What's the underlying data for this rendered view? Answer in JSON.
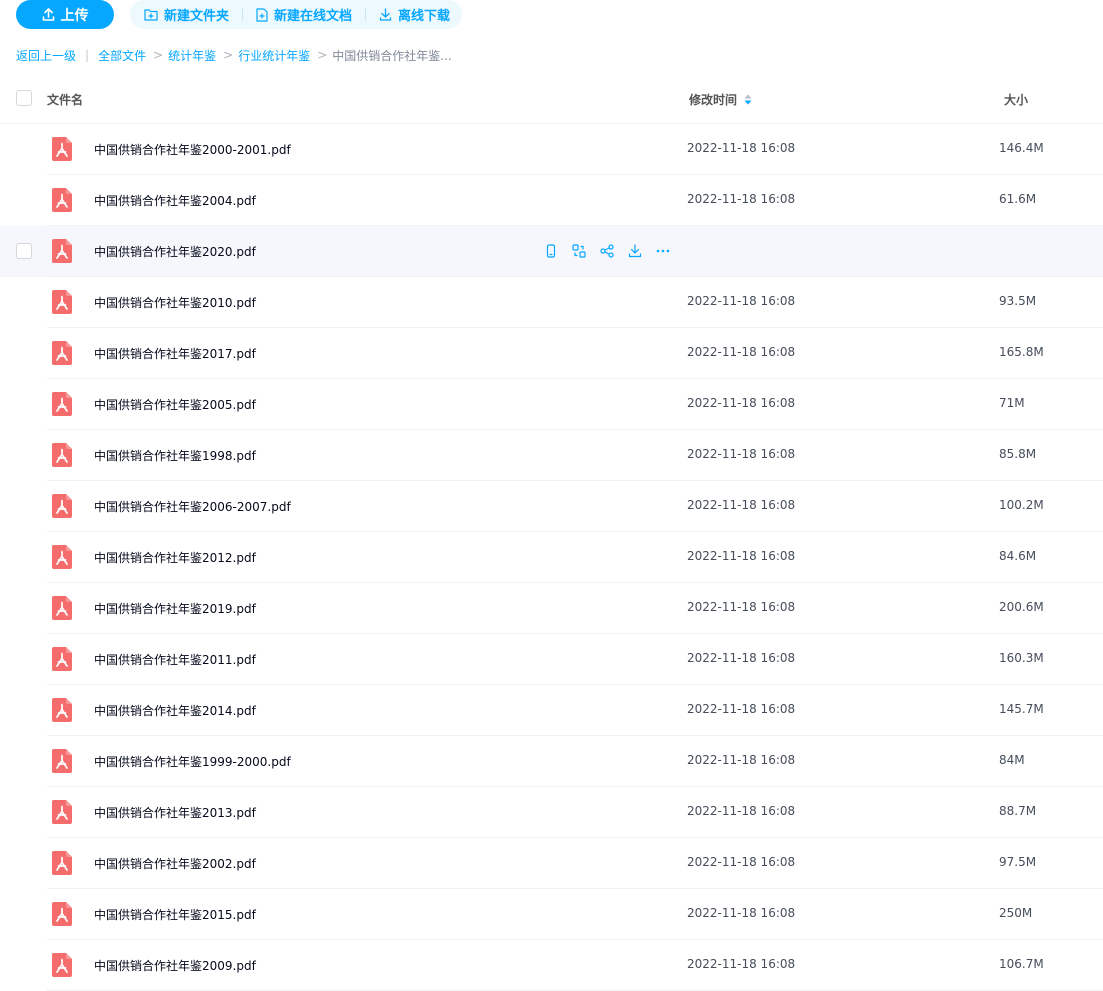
{
  "toolbar": {
    "upload_label": "上传",
    "new_folder_label": "新建文件夹",
    "new_online_doc_label": "新建在线文档",
    "offline_download_label": "离线下载"
  },
  "breadcrumb": {
    "back": "返回上一级",
    "items": [
      "全部文件",
      "统计年鉴",
      "行业统计年鉴"
    ],
    "current": "中国供销合作社年鉴..."
  },
  "columns": {
    "name": "文件名",
    "modified": "修改时间",
    "size": "大小"
  },
  "colors": {
    "accent": "#06a7ff",
    "pdf_icon": "#f56c6c"
  },
  "files": [
    {
      "name": "中国供销合作社年鉴2000-2001.pdf",
      "time": "2022-11-18 16:08",
      "size": "146.4M"
    },
    {
      "name": "中国供销合作社年鉴2004.pdf",
      "time": "2022-11-18 16:08",
      "size": "61.6M"
    },
    {
      "name": "中国供销合作社年鉴2020.pdf",
      "time": "",
      "size": ""
    },
    {
      "name": "中国供销合作社年鉴2010.pdf",
      "time": "2022-11-18 16:08",
      "size": "93.5M"
    },
    {
      "name": "中国供销合作社年鉴2017.pdf",
      "time": "2022-11-18 16:08",
      "size": "165.8M"
    },
    {
      "name": "中国供销合作社年鉴2005.pdf",
      "time": "2022-11-18 16:08",
      "size": "71M"
    },
    {
      "name": "中国供销合作社年鉴1998.pdf",
      "time": "2022-11-18 16:08",
      "size": "85.8M"
    },
    {
      "name": "中国供销合作社年鉴2006-2007.pdf",
      "time": "2022-11-18 16:08",
      "size": "100.2M"
    },
    {
      "name": "中国供销合作社年鉴2012.pdf",
      "time": "2022-11-18 16:08",
      "size": "84.6M"
    },
    {
      "name": "中国供销合作社年鉴2019.pdf",
      "time": "2022-11-18 16:08",
      "size": "200.6M"
    },
    {
      "name": "中国供销合作社年鉴2011.pdf",
      "time": "2022-11-18 16:08",
      "size": "160.3M"
    },
    {
      "name": "中国供销合作社年鉴2014.pdf",
      "time": "2022-11-18 16:08",
      "size": "145.7M"
    },
    {
      "name": "中国供销合作社年鉴1999-2000.pdf",
      "time": "2022-11-18 16:08",
      "size": "84M"
    },
    {
      "name": "中国供销合作社年鉴2013.pdf",
      "time": "2022-11-18 16:08",
      "size": "88.7M"
    },
    {
      "name": "中国供销合作社年鉴2002.pdf",
      "time": "2022-11-18 16:08",
      "size": "97.5M"
    },
    {
      "name": "中国供销合作社年鉴2015.pdf",
      "time": "2022-11-18 16:08",
      "size": "250M"
    },
    {
      "name": "中国供销合作社年鉴2009.pdf",
      "time": "2022-11-18 16:08",
      "size": "106.7M"
    }
  ],
  "hover_row_actions": [
    "mobile-icon",
    "convert-icon",
    "share-icon",
    "download-icon",
    "more-icon"
  ]
}
